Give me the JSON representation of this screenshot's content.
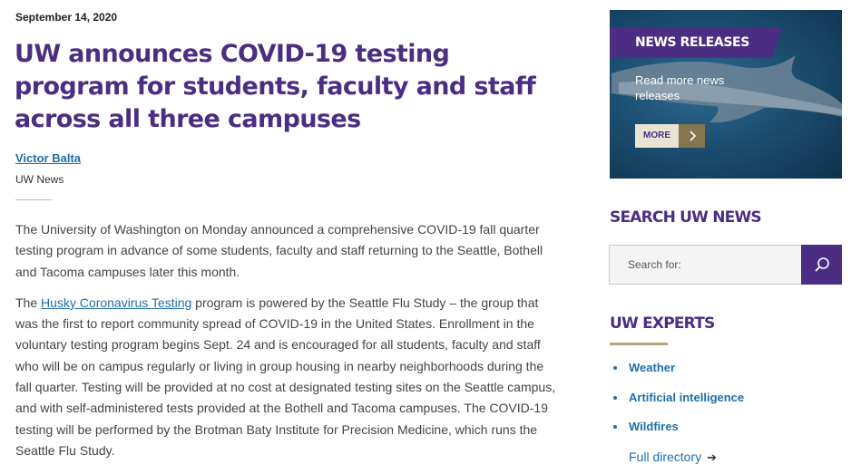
{
  "article": {
    "date": "September 14, 2020",
    "headline": "UW announces COVID-19 testing program for students, faculty and staff across all three campuses",
    "author": "Victor Balta",
    "outlet": "UW News",
    "p1": "The University of Washington on Monday announced a comprehensive COVID-19 fall quarter testing program in advance of some students, faculty and staff returning to the Seattle, Bothell and Tacoma campuses later this month.",
    "p2_before": "The ",
    "p2_link": "Husky Coronavirus Testing",
    "p2_after": " program is powered by the Seattle Flu Study – the group that was the first to report community spread of COVID-19 in the United States. Enrollment in the voluntary testing program begins Sept. 24 and is encouraged for all students, faculty and staff who will be on campus regularly or living in group housing in nearby neighborhoods during the fall quarter. Testing will be provided at no cost at designated testing sites on the Seattle campus, and with self-administered tests provided at the Bothell and Tacoma campuses. The COVID-19 testing will be performed by the Brotman Baty Institute for Precision Medicine, which runs the Seattle Flu Study."
  },
  "sidebar": {
    "promo": {
      "tag": "NEWS RELEASES",
      "text": "Read more news releases",
      "more_label": "MORE",
      "more_icon": "chevron-right-icon"
    },
    "search": {
      "heading": "SEARCH UW NEWS",
      "placeholder": "Search for:",
      "button_icon": "search-icon"
    },
    "experts": {
      "heading": "UW EXPERTS",
      "items": [
        "Weather",
        "Artificial intelligence",
        "Wildfires"
      ],
      "full_directory": "Full directory",
      "full_directory_icon": "arrow-right-icon"
    }
  },
  "colors": {
    "uw_purple": "#4b2e83",
    "uw_gold": "#b7a57a",
    "link_blue": "#1f6ea8"
  }
}
